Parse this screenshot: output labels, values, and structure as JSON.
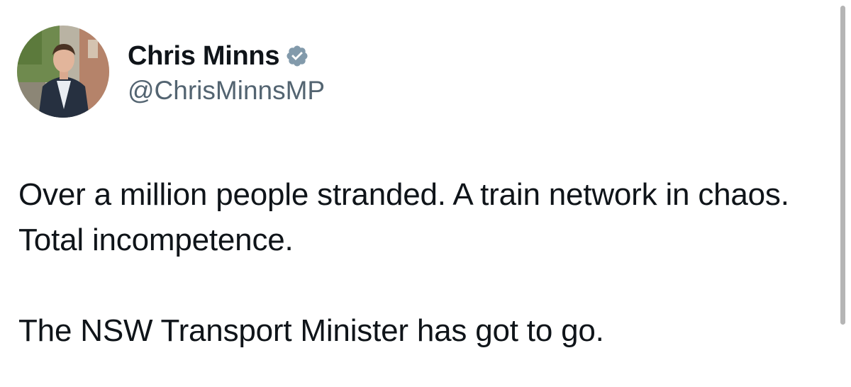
{
  "author": {
    "display_name": "Chris Minns",
    "handle": "@ChrisMinnsMP",
    "verified_icon": "verified-badge-icon",
    "verified_color": "#829aab"
  },
  "tweet": {
    "paragraph_1": "Over a million people stranded. A train network in chaos. Total incompetence.",
    "paragraph_2": "The NSW Transport Minister has got to go."
  },
  "colors": {
    "text": "#0f1419",
    "secondary_text": "#536471",
    "background": "#ffffff"
  }
}
